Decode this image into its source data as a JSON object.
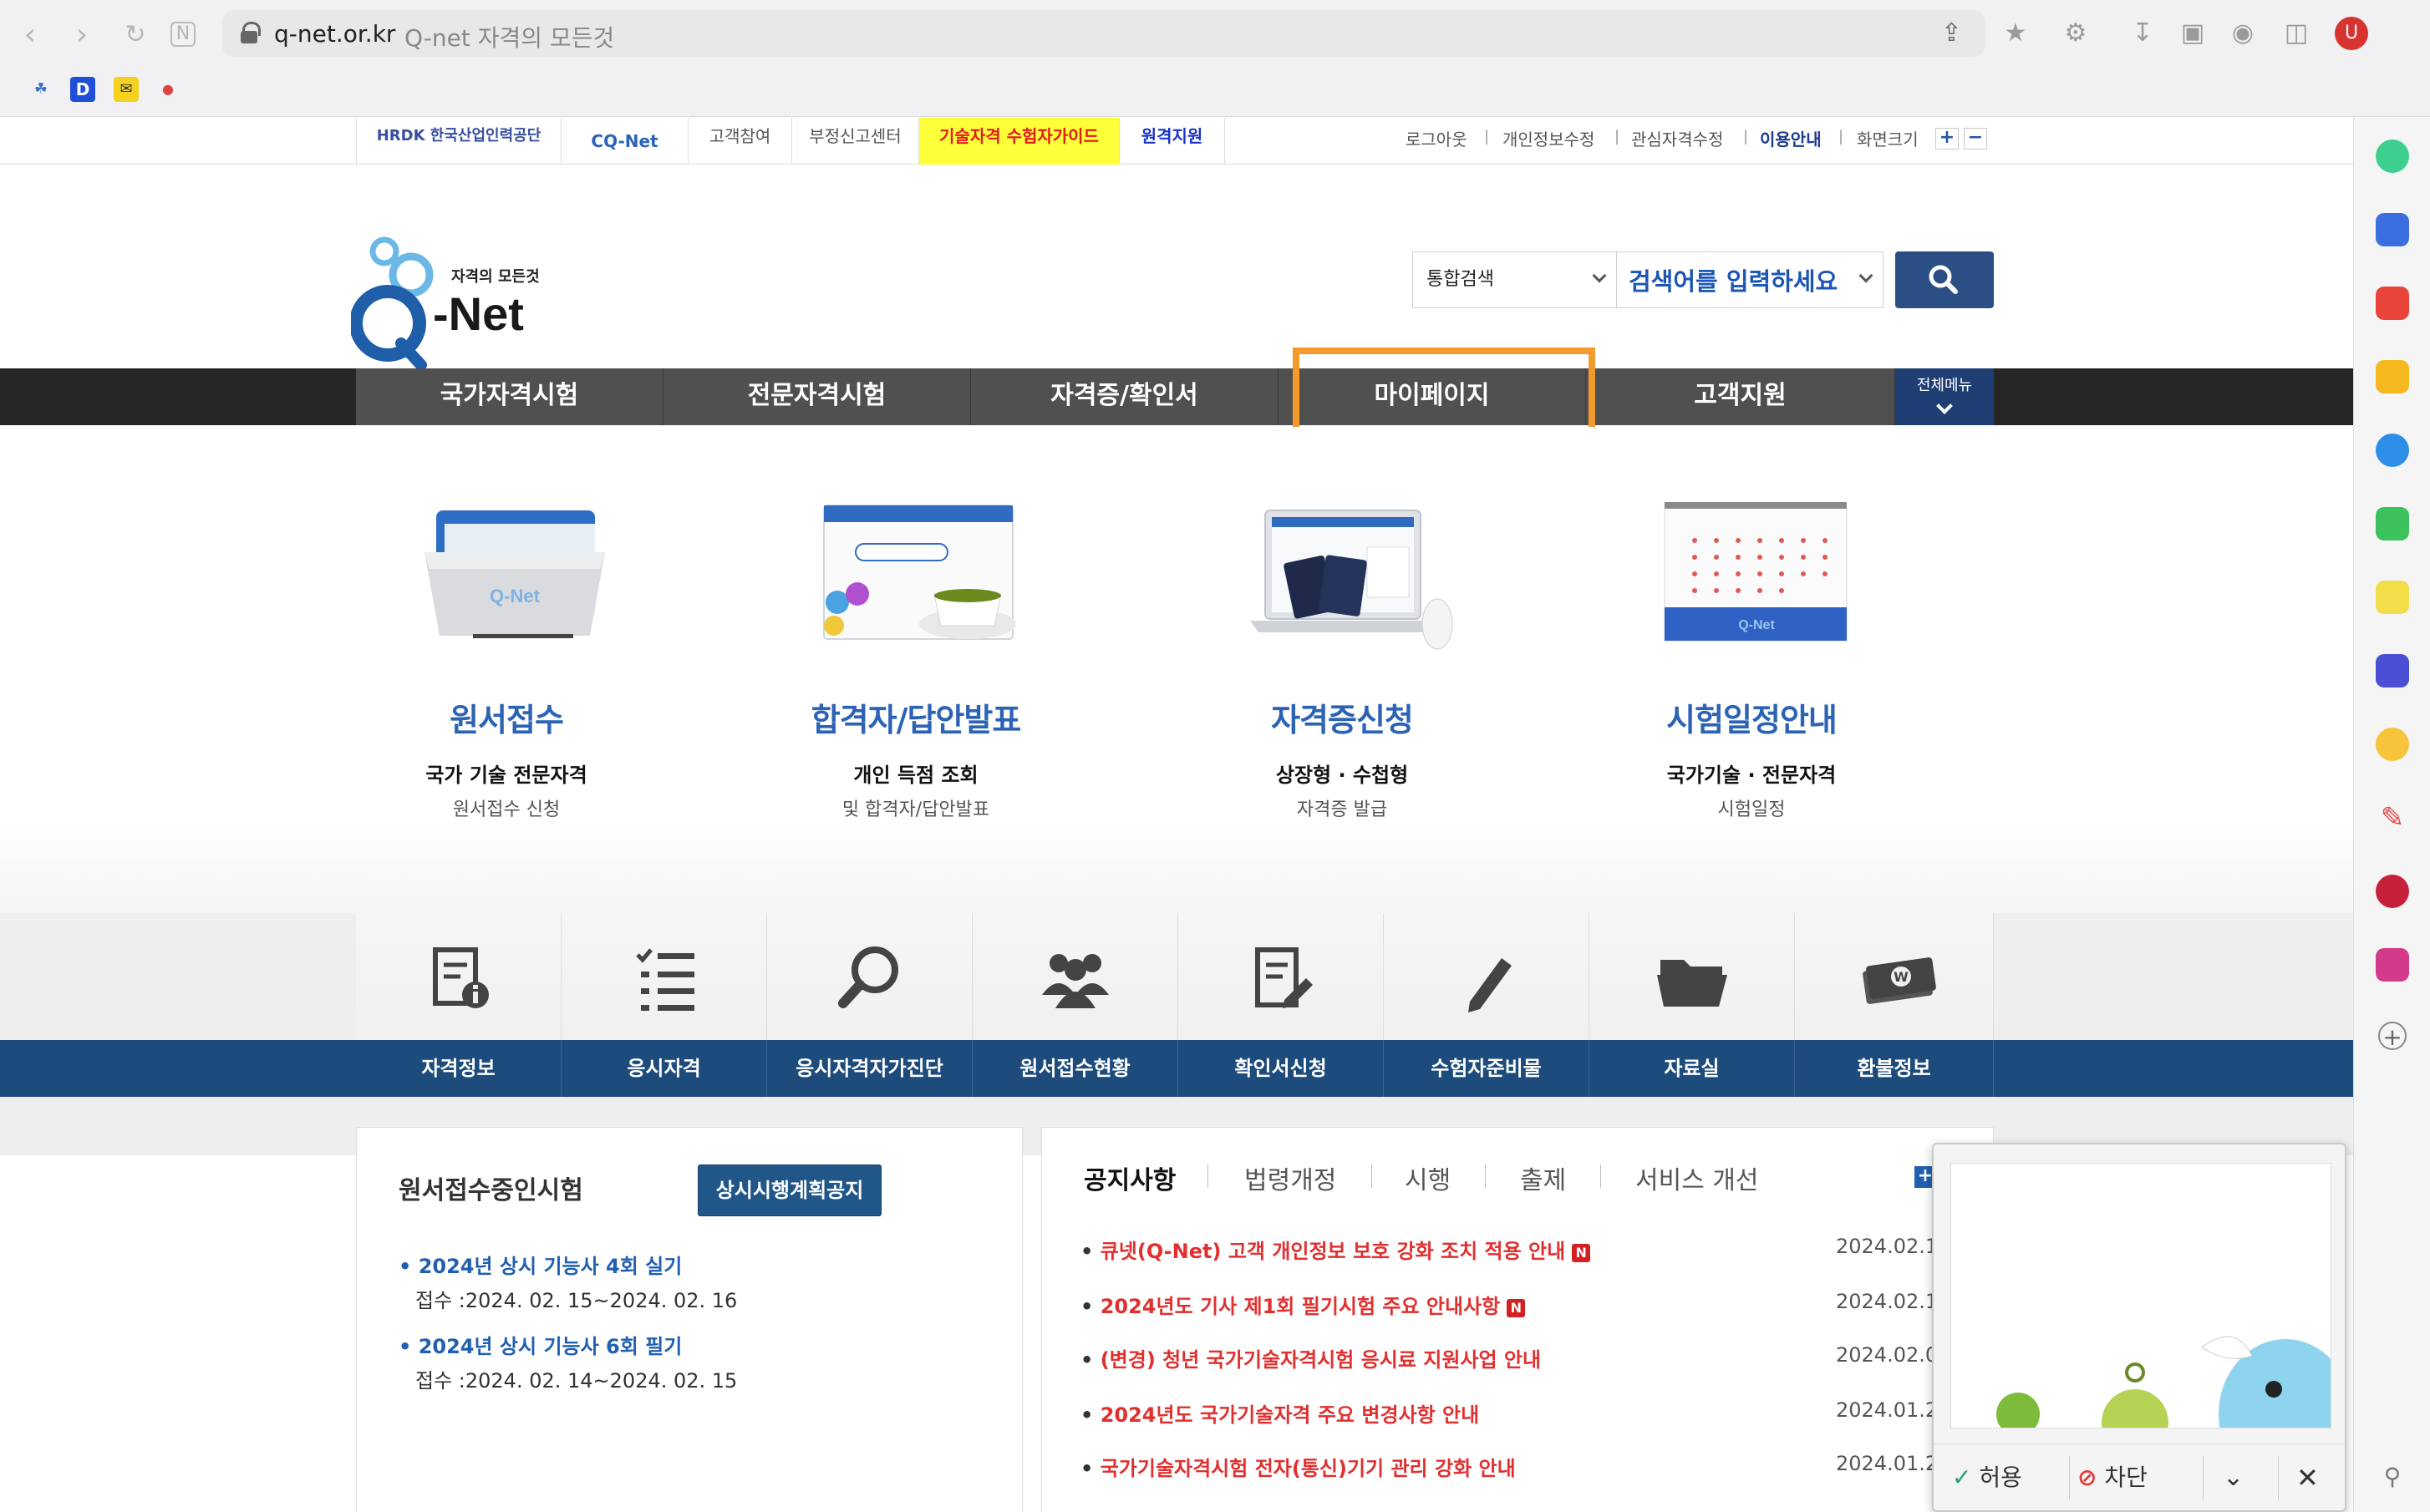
{
  "browser": {
    "url_domain": "q-net.or.kr",
    "tab_title": "Q-net 자격의 모든것",
    "profile_initial": "U",
    "bookmarks": [
      "D"
    ]
  },
  "util_bar": {
    "hrdk_label": "HRDK 한국산업인력공단",
    "qnet_label": "CQ-Net",
    "links": [
      "고객참여",
      "부정신고센터",
      "기술자격 수험자가이드",
      "원격지원"
    ],
    "top_links": [
      "로그아웃",
      "개인정보수정",
      "관심자격수정",
      "이용안내",
      "화면크기"
    ],
    "zoom_in": "+",
    "zoom_out": "−"
  },
  "logo": {
    "tagline": "자격의 모든것",
    "name": "-Net"
  },
  "search": {
    "scope": "통합검색",
    "placeholder": "검색어를 입력하세요"
  },
  "gnb": {
    "items": [
      "국가자격시험",
      "전문자격시험",
      "자격증/확인서",
      "마이페이지",
      "고객지원"
    ],
    "all_menu": "전체메뉴"
  },
  "features": [
    {
      "title": "원서접수",
      "subtitle": "국가 기술 전문자격",
      "desc": "원서접수 신청"
    },
    {
      "title": "합격자/답안발표",
      "subtitle": "개인 득점 조회",
      "desc": "및 합격자/답안발표"
    },
    {
      "title": "자격증신청",
      "subtitle": "상장형 · 수첩형",
      "desc": "자격증 발급"
    },
    {
      "title": "시험일정안내",
      "subtitle": "국가기술 · 전문자격",
      "desc": "시험일정"
    }
  ],
  "quick_links": [
    "자격정보",
    "응시자격",
    "응시자격자가진단",
    "원서접수현황",
    "확인서신청",
    "수험자준비물",
    "자료실",
    "환불정보"
  ],
  "exams_panel": {
    "title": "원서접수중인시험",
    "button": "상시시행계획공지",
    "exams": [
      {
        "name": "2024년 상시 기능사 4회 실기",
        "date": "접수 :2024. 02. 15~2024. 02. 16"
      },
      {
        "name": "2024년 상시 기능사 6회 필기",
        "date": "접수 :2024. 02. 14~2024. 02. 15"
      }
    ]
  },
  "notice_panel": {
    "tabs": [
      "공지사항",
      "법령개정",
      "시행",
      "출제",
      "서비스 개선"
    ],
    "more": "+",
    "new_badge": "N",
    "items": [
      {
        "title": "큐넷(Q-Net) 고객 개인정보 보호 강화 조치 적용 안내",
        "date": "2024.02.1",
        "new": true
      },
      {
        "title": "2024년도 기사 제1회 필기시험 주요 안내사항",
        "date": "2024.02.1",
        "new": true
      },
      {
        "title": "(변경) 청년 국가기술자격시험 응시료 지원사업 안내",
        "date": "2024.02.0",
        "new": false
      },
      {
        "title": "2024년도 국가기술자격 주요 변경사항 안내",
        "date": "2024.01.2",
        "new": false
      },
      {
        "title": "국가기술자격시험 전자(통신)기기 관리 강화 안내",
        "date": "2024.01.2",
        "new": false
      }
    ]
  },
  "popup": {
    "allow": "허용",
    "block": "차단"
  },
  "colors": {
    "accent_blue": "#2d63b5",
    "gnb_dark": "#505050",
    "quick_blue": "#1c4b7c",
    "highlight": "#f29a2e",
    "notice_red": "#e03030"
  }
}
